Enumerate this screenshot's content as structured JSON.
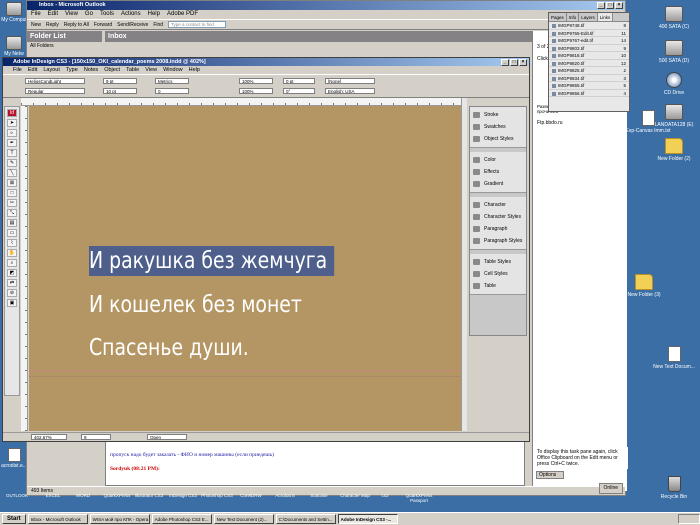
{
  "desktop": {
    "right_icons": [
      "400 SATA (C)",
      "500 SATA (D)",
      "CD Drive",
      "LANDATA128 (E)",
      "Exp-Canvas Imm.txt",
      "New Folder (2)",
      "New Folder (3)",
      "New Text Docum...",
      "Recycle Bin"
    ],
    "left_icons": [
      "My Comput",
      "My Netw"
    ],
    "left_bottom_icon": "acrodist.e..."
  },
  "outlook": {
    "title": "Inbox - Microsoft Outlook",
    "menu": [
      "File",
      "Edit",
      "View",
      "Go",
      "Tools",
      "Actions",
      "Help",
      "Adobe PDF"
    ],
    "toolbar": [
      "New",
      "Reply",
      "Reply to All",
      "Forward",
      "Send/Receive",
      "Find"
    ],
    "contact_placeholder": "Type a contact to find",
    "folder_list_label": "Folder List",
    "all_folders_label": "All Folders",
    "inbox_label": "Inbox",
    "right_pane_items": [
      "3 of 2",
      "Click a",
      "Ftp.bbdo.ru"
    ],
    "right_pane_note": "Разверните сообщение, чтобы прочитать",
    "clipboard_hint": "To display this task pane again, click Office Clipboard on the Edit menu or press Ctrl+C twice.",
    "options_label": "Options",
    "online_label": "Online",
    "status_items": "493 Items",
    "mail_line_1": "пропуск надо будет заказать - ФИО и номер машины (если приедешь)",
    "mail_line_2": "Sordyuk (08:21 PM):"
  },
  "indesign": {
    "title": "Adobe InDesign CS3 - [150x150_OKI_calendar_poems 2008.indd @ 402%]",
    "menu": [
      "File",
      "Edit",
      "Layout",
      "Type",
      "Notes",
      "Object",
      "Table",
      "View",
      "Window",
      "Help"
    ],
    "control": {
      "font_name": "HeliosCondLight",
      "font_style": "Regular",
      "font_size": "9 pt",
      "leading": "10 pt",
      "kerning": "Metrics",
      "tracking": "0",
      "scale_v": "100%",
      "scale_h": "100%",
      "baseline": "0 pt",
      "skew": "0°",
      "char_style": "[None]",
      "language": "English: USA"
    },
    "poem_lines": [
      "И ракушка без жемчуга",
      "И кошелек без монет",
      "Спасенье души."
    ],
    "panels": [
      [
        "Stroke",
        "Swatches",
        "Object Styles"
      ],
      [
        "Color",
        "Effects",
        "Gradient"
      ],
      [
        "Character",
        "Character Styles",
        "Paragraph",
        "Paragraph Styles"
      ],
      [
        "Table Styles",
        "Cell Styles",
        "Table"
      ]
    ],
    "zoom": "402,67%",
    "page": "9",
    "status_open": "Open",
    "colors": {
      "canvas": "#b49664",
      "selection": "#4d5f8a",
      "text": "#ffffff"
    }
  },
  "links_panel": {
    "tabs": [
      "Pages",
      "Info",
      "Layers",
      "Links"
    ],
    "rows": [
      {
        "name": "IMGP9748.tif",
        "page": "8"
      },
      {
        "name": "IMGP9765-Edit.tif",
        "page": "11"
      },
      {
        "name": "IMGP9767-edit.tif",
        "page": "14"
      },
      {
        "name": "IMGP9803.tif",
        "page": "9"
      },
      {
        "name": "IMGP9818.tif",
        "page": "10"
      },
      {
        "name": "IMGP9820.tif",
        "page": "12"
      },
      {
        "name": "IMGP9825.tif",
        "page": "2"
      },
      {
        "name": "IMGP9834.tif",
        "page": "3"
      },
      {
        "name": "IMGP9855.tif",
        "page": "5"
      },
      {
        "name": "IMGP9856.tif",
        "page": "4"
      }
    ]
  },
  "quicklaunch": [
    "OUTLOOK",
    "EXCEL",
    "WORD",
    "QuarkXPress",
    "Illustrator CS3",
    "InDesign CS3",
    "Photoshop CS3",
    "CorelDRW",
    "Acrobat 8",
    "Suitcase",
    "Character Map",
    "cs3",
    "QuarkXPress Passport"
  ],
  "taskbar": {
    "start": "Start",
    "tasks": [
      "Inbox - Microsoft Outlook",
      "WISA мой про КПК - Opera",
      "Adobe Photoshop CS3 E...",
      "New Text Document (2)...",
      "C:\\Documents and Settin...",
      "Adobe InDesign CS3 -..."
    ]
  }
}
